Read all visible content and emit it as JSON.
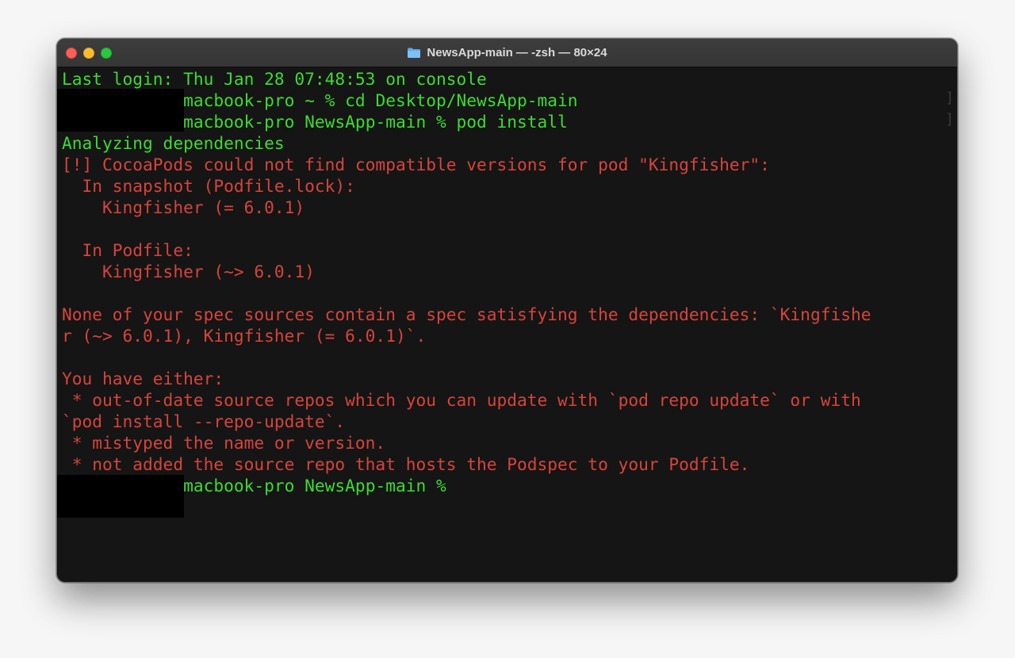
{
  "window": {
    "title": "NewsApp-main — -zsh — 80×24"
  },
  "terminal": {
    "lines": [
      {
        "text": "Last login: Thu Jan 28 07:48:53 on console",
        "color": "green",
        "indent": ""
      },
      {
        "text": "@macbook-pro ~ % cd Desktop/NewsApp-main",
        "color": "green",
        "indent": "           "
      },
      {
        "text": "@macbook-pro NewsApp-main % pod install",
        "color": "green",
        "indent": "           "
      },
      {
        "text": "Analyzing dependencies",
        "color": "green",
        "indent": ""
      },
      {
        "text": "[!] CocoaPods could not find compatible versions for pod \"Kingfisher\":",
        "color": "red",
        "indent": ""
      },
      {
        "text": "  In snapshot (Podfile.lock):",
        "color": "red",
        "indent": ""
      },
      {
        "text": "    Kingfisher (= 6.0.1)",
        "color": "red",
        "indent": ""
      },
      {
        "text": "",
        "color": "red",
        "indent": ""
      },
      {
        "text": "  In Podfile:",
        "color": "red",
        "indent": ""
      },
      {
        "text": "    Kingfisher (~> 6.0.1)",
        "color": "red",
        "indent": ""
      },
      {
        "text": "",
        "color": "red",
        "indent": ""
      },
      {
        "text": "None of your spec sources contain a spec satisfying the dependencies: `Kingfishe",
        "color": "red",
        "indent": ""
      },
      {
        "text": "r (~> 6.0.1), Kingfisher (= 6.0.1)`.",
        "color": "red",
        "indent": ""
      },
      {
        "text": "",
        "color": "red",
        "indent": ""
      },
      {
        "text": "You have either:",
        "color": "red",
        "indent": ""
      },
      {
        "text": " * out-of-date source repos which you can update with `pod repo update` or with",
        "color": "red",
        "indent": ""
      },
      {
        "text": "`pod install --repo-update`.",
        "color": "red",
        "indent": ""
      },
      {
        "text": " * mistyped the name or version.",
        "color": "red",
        "indent": ""
      },
      {
        "text": " * not added the source repo that hosts the Podspec to your Podfile.",
        "color": "red",
        "indent": ""
      },
      {
        "text": "@macbook-pro NewsApp-main % ",
        "color": "green",
        "indent": "           "
      }
    ]
  },
  "colors": {
    "green": "#3cdc2f",
    "red": "#d7443b",
    "background": "#151515",
    "titlebar": "#3a3a3a"
  }
}
